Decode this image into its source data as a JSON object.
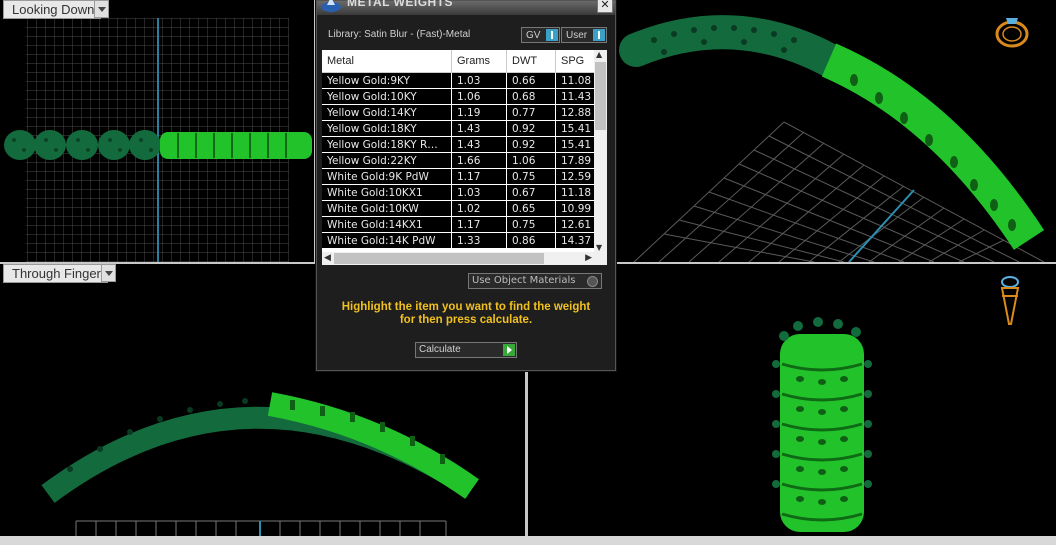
{
  "viewports": {
    "top_left": {
      "label": "Looking Down"
    },
    "bottom_left": {
      "label": "Through Finger"
    }
  },
  "dialog": {
    "title": "METAL WEIGHTS",
    "close_glyph": "✕",
    "library_text": "Library: Satin Blur - (Fast)-Metal",
    "toggle_gv": "GV",
    "toggle_user": "User",
    "columns": [
      "Metal",
      "Grams",
      "DWT",
      "SPG"
    ],
    "rows": [
      [
        "Yellow Gold:9KY",
        "1.03",
        "0.66",
        "11.08"
      ],
      [
        "Yellow Gold:10KY",
        "1.06",
        "0.68",
        "11.43"
      ],
      [
        "Yellow Gold:14KY",
        "1.19",
        "0.77",
        "12.88"
      ],
      [
        "Yellow Gold:18KY",
        "1.43",
        "0.92",
        "15.41"
      ],
      [
        "Yellow Gold:18KY R…",
        "1.43",
        "0.92",
        "15.41"
      ],
      [
        "Yellow Gold:22KY",
        "1.66",
        "1.06",
        "17.89"
      ],
      [
        "White Gold:9K PdW",
        "1.17",
        "0.75",
        "12.59"
      ],
      [
        "White Gold:10KX1",
        "1.03",
        "0.67",
        "11.18"
      ],
      [
        "White Gold:10KW",
        "1.02",
        "0.65",
        "10.99"
      ],
      [
        "White Gold:14KX1",
        "1.17",
        "0.75",
        "12.61"
      ],
      [
        "White Gold:14K PdW",
        "1.33",
        "0.86",
        "14.37"
      ]
    ],
    "use_object_materials": "Use Object Materials",
    "hint_line1": "Highlight the item you want to find the weight",
    "hint_line2": "for then press calculate.",
    "calculate_label": "Calculate"
  },
  "colors": {
    "metal_green": "#22c32a",
    "hint_yellow": "#f0c020",
    "toggle_blue": "#3aa0c8"
  }
}
